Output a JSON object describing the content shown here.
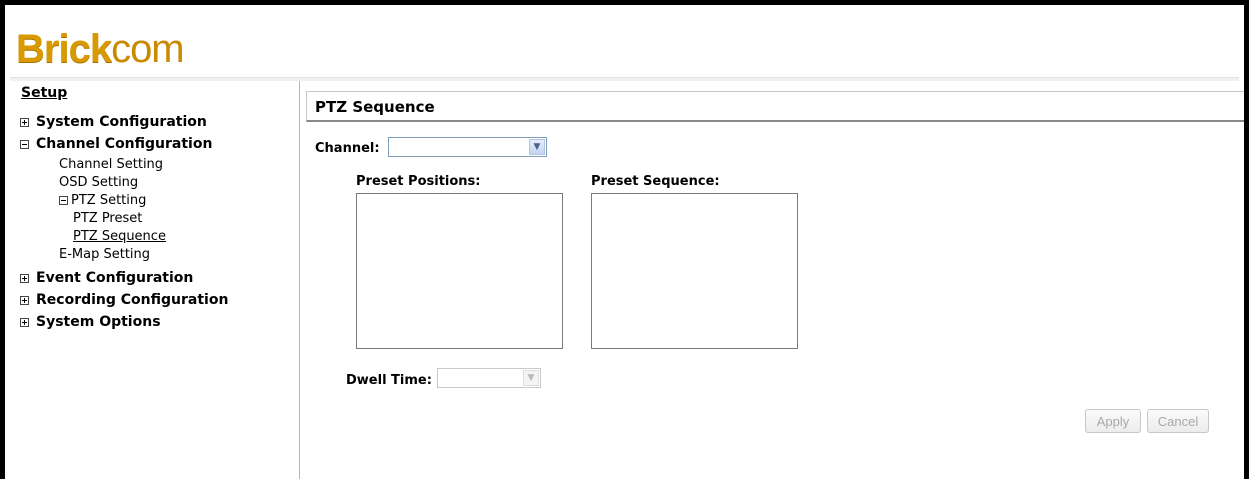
{
  "brand": {
    "name_bold": "Brick",
    "name_light": "com"
  },
  "sidebar": {
    "setup_label": "Setup",
    "system_configuration": "System Configuration",
    "channel_configuration": "Channel Configuration",
    "channel_setting": "Channel Setting",
    "osd_setting": "OSD Setting",
    "ptz_setting": "PTZ Setting",
    "ptz_preset": "PTZ Preset",
    "ptz_sequence": "PTZ Sequence",
    "emap_setting": "E-Map Setting",
    "event_configuration": "Event Configuration",
    "recording_configuration": "Recording Configuration",
    "system_options": "System Options"
  },
  "main": {
    "title": "PTZ Sequence",
    "channel_label": "Channel:",
    "channel_value": "",
    "preset_positions_label": "Preset Positions:",
    "preset_sequence_label": "Preset Sequence:",
    "dwell_time_label": "Dwell Time:",
    "dwell_time_value": "",
    "apply_label": "Apply",
    "cancel_label": "Cancel"
  },
  "colors": {
    "brand_accent": "#d99a00",
    "frame": "#000000",
    "disabled_text": "#a8a8a8"
  }
}
